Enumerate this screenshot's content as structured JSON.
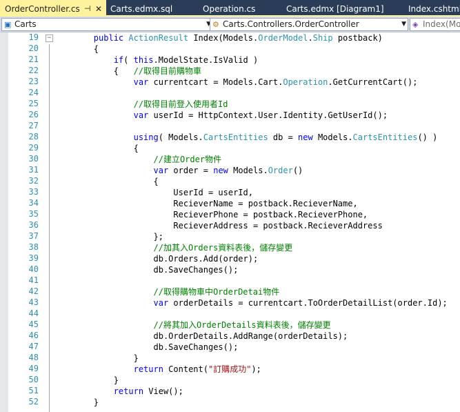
{
  "tabs": [
    {
      "label": "OrderController.cs",
      "active": true,
      "pin": "⊣",
      "close": "✕"
    },
    {
      "label": "Carts.edmx.sql",
      "active": false
    },
    {
      "label": "Operation.cs",
      "active": false
    },
    {
      "label": "Carts.edmx [Diagram1]",
      "active": false
    },
    {
      "label": "Index.cshtml",
      "active": false
    }
  ],
  "navbar": {
    "project": "Carts",
    "type": "Carts.Controllers.OrderController",
    "member": "Index(Mo"
  },
  "colors": {
    "tab_strip": "#2b3c59",
    "active_tab": "#fff29d",
    "keyword": "#0000ff",
    "type": "#2b91af",
    "comment": "#008000",
    "string": "#a31515",
    "line_number": "#2b91af"
  },
  "editor": {
    "lines": [
      {
        "n": "19",
        "fold": "−",
        "tokens": [
          {
            "t": "        "
          },
          {
            "t": "public",
            "c": "kw"
          },
          {
            "t": " "
          },
          {
            "t": "ActionResult",
            "c": "ty"
          },
          {
            "t": " Index(Models."
          },
          {
            "t": "OrderModel",
            "c": "ty"
          },
          {
            "t": "."
          },
          {
            "t": "Ship",
            "c": "ty"
          },
          {
            "t": " postback)"
          }
        ]
      },
      {
        "n": "20",
        "tokens": [
          {
            "t": "        {"
          }
        ]
      },
      {
        "n": "21",
        "tokens": [
          {
            "t": "            "
          },
          {
            "t": "if",
            "c": "kw"
          },
          {
            "t": "( "
          },
          {
            "t": "this",
            "c": "kw"
          },
          {
            "t": ".ModelState.IsValid )"
          }
        ]
      },
      {
        "n": "22",
        "tokens": [
          {
            "t": "            {   "
          },
          {
            "t": "//取得目前購物車",
            "c": "cm"
          }
        ]
      },
      {
        "n": "23",
        "tokens": [
          {
            "t": "                "
          },
          {
            "t": "var",
            "c": "kw"
          },
          {
            "t": " currentcart = Models.Cart."
          },
          {
            "t": "Operation",
            "c": "ty"
          },
          {
            "t": ".GetCurrentCart();"
          }
        ]
      },
      {
        "n": "24",
        "tokens": [
          {
            "t": ""
          }
        ]
      },
      {
        "n": "25",
        "tokens": [
          {
            "t": "                "
          },
          {
            "t": "//取得目前登入使用者Id",
            "c": "cm"
          }
        ]
      },
      {
        "n": "26",
        "tokens": [
          {
            "t": "                "
          },
          {
            "t": "var",
            "c": "kw"
          },
          {
            "t": " userId = HttpContext.User.Identity.GetUserId();"
          }
        ]
      },
      {
        "n": "27",
        "tokens": [
          {
            "t": ""
          }
        ]
      },
      {
        "n": "28",
        "tokens": [
          {
            "t": "                "
          },
          {
            "t": "using",
            "c": "kw"
          },
          {
            "t": "( Models."
          },
          {
            "t": "CartsEntities",
            "c": "ty"
          },
          {
            "t": " db = "
          },
          {
            "t": "new",
            "c": "kw"
          },
          {
            "t": " Models."
          },
          {
            "t": "CartsEntities",
            "c": "ty"
          },
          {
            "t": "() )"
          }
        ]
      },
      {
        "n": "29",
        "tokens": [
          {
            "t": "                {"
          }
        ]
      },
      {
        "n": "30",
        "tokens": [
          {
            "t": "                    "
          },
          {
            "t": "//建立Order物件",
            "c": "cm"
          }
        ]
      },
      {
        "n": "31",
        "tokens": [
          {
            "t": "                    "
          },
          {
            "t": "var",
            "c": "kw"
          },
          {
            "t": " order = "
          },
          {
            "t": "new",
            "c": "kw"
          },
          {
            "t": " Models."
          },
          {
            "t": "Order",
            "c": "ty"
          },
          {
            "t": "()"
          }
        ]
      },
      {
        "n": "32",
        "tokens": [
          {
            "t": "                    {"
          }
        ]
      },
      {
        "n": "33",
        "tokens": [
          {
            "t": "                        UserId = userId,"
          }
        ]
      },
      {
        "n": "34",
        "tokens": [
          {
            "t": "                        RecieverName = postback.RecieverName,"
          }
        ]
      },
      {
        "n": "35",
        "tokens": [
          {
            "t": "                        RecieverPhone = postback.RecieverPhone,"
          }
        ]
      },
      {
        "n": "36",
        "tokens": [
          {
            "t": "                        RecieverAddress = postback.RecieverAddress"
          }
        ]
      },
      {
        "n": "37",
        "tokens": [
          {
            "t": "                    };"
          }
        ]
      },
      {
        "n": "38",
        "tokens": [
          {
            "t": "                    "
          },
          {
            "t": "//加其入Orders資料表後，儲存變更",
            "c": "cm"
          }
        ]
      },
      {
        "n": "39",
        "tokens": [
          {
            "t": "                    db.Orders.Add(order);"
          }
        ]
      },
      {
        "n": "40",
        "tokens": [
          {
            "t": "                    db.SaveChanges();"
          }
        ]
      },
      {
        "n": "41",
        "tokens": [
          {
            "t": ""
          }
        ]
      },
      {
        "n": "42",
        "tokens": [
          {
            "t": "                    "
          },
          {
            "t": "//取得購物車中OrderDetai物件",
            "c": "cm"
          }
        ]
      },
      {
        "n": "43",
        "tokens": [
          {
            "t": "                    "
          },
          {
            "t": "var",
            "c": "kw"
          },
          {
            "t": " orderDetails = currentcart.ToOrderDetailList(order.Id);"
          }
        ]
      },
      {
        "n": "44",
        "tokens": [
          {
            "t": ""
          }
        ]
      },
      {
        "n": "45",
        "tokens": [
          {
            "t": "                    "
          },
          {
            "t": "//將其加入OrderDetails資料表後，儲存變更",
            "c": "cm"
          }
        ]
      },
      {
        "n": "46",
        "tokens": [
          {
            "t": "                    db.OrderDetails.AddRange(orderDetails);"
          }
        ]
      },
      {
        "n": "47",
        "tokens": [
          {
            "t": "                    db.SaveChanges();"
          }
        ]
      },
      {
        "n": "48",
        "tokens": [
          {
            "t": "                }"
          }
        ]
      },
      {
        "n": "49",
        "tokens": [
          {
            "t": "                "
          },
          {
            "t": "return",
            "c": "kw"
          },
          {
            "t": " Content("
          },
          {
            "t": "\"訂購成功\"",
            "c": "st"
          },
          {
            "t": ");"
          }
        ]
      },
      {
        "n": "50",
        "tokens": [
          {
            "t": "            }"
          }
        ]
      },
      {
        "n": "51",
        "tokens": [
          {
            "t": "            "
          },
          {
            "t": "return",
            "c": "kw"
          },
          {
            "t": " View();"
          }
        ]
      },
      {
        "n": "52",
        "tokens": [
          {
            "t": "        }"
          }
        ]
      }
    ]
  }
}
